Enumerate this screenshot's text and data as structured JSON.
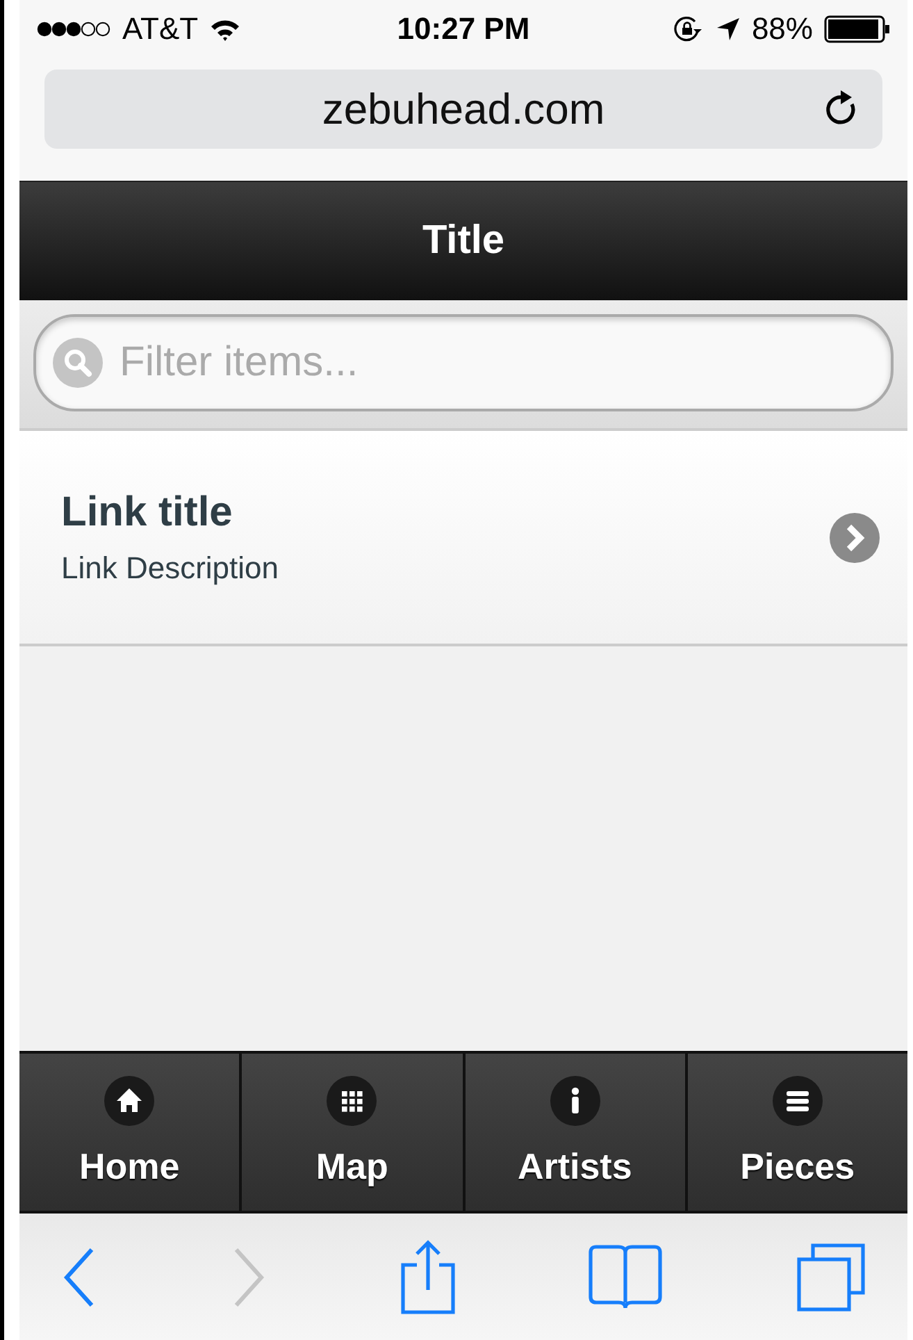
{
  "status_bar": {
    "carrier": "AT&T",
    "time": "10:27 PM",
    "battery": "88%"
  },
  "address_bar": {
    "url": "zebuhead.com"
  },
  "header": {
    "title": "Title"
  },
  "filter": {
    "placeholder": "Filter items..."
  },
  "list": [
    {
      "title": "Link title",
      "description": "Link Description"
    }
  ],
  "navbar": [
    {
      "label": "Home",
      "kind": "home"
    },
    {
      "label": "Map",
      "kind": "map"
    },
    {
      "label": "Artists",
      "kind": "artists"
    },
    {
      "label": "Pieces",
      "kind": "pieces"
    }
  ],
  "toolbar": {
    "back_disabled": false,
    "forward_disabled": true
  }
}
